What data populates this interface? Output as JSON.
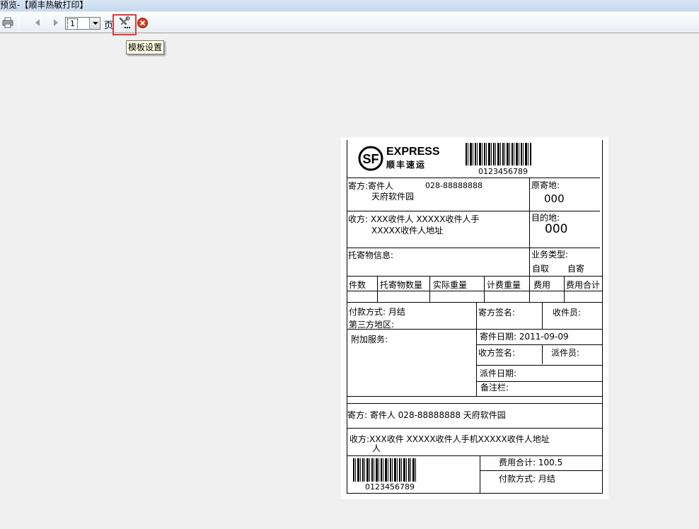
{
  "window": {
    "title": "预览-【顺丰热敏打印】"
  },
  "toolbar": {
    "page_select_value": "1",
    "page_word": "页",
    "tooltip": "模板设置"
  },
  "icons": [
    "printer-icon",
    "prev-page-icon",
    "next-page-icon",
    "template-settings-icon",
    "close-icon"
  ],
  "label": {
    "logo_brand": "EXPRESS",
    "logo_cn": "顺丰速运",
    "tracking_no": "0123456789",
    "sender": {
      "title": "寄方:寄件人",
      "phone": "028-88888888",
      "address": "天府软件园"
    },
    "origin": {
      "title": "原寄地:",
      "value": "000"
    },
    "receiver": {
      "line1": "收方: XXX收件人   XXXXX收件人手",
      "line2": "XXXXX收件人地址"
    },
    "destination": {
      "title": "目的地:",
      "value": "000"
    },
    "cargo_info": "托寄物信息:",
    "biz_type": {
      "title": "业务类型:",
      "opt1": "自取",
      "opt2": "自寄"
    },
    "table_headers": [
      "件数",
      "托寄物数量",
      "实际重量",
      "计费重量",
      "费用",
      "费用合计"
    ],
    "payment": "付款方式: 月结",
    "third_party": "第三方地区:",
    "sender_sign": "寄方签名:",
    "collector": "收件员:",
    "send_date": "寄件日期:  2011-09-09",
    "extra_service": "附加服务:",
    "receiver_sign": "收方签名:",
    "dispatcher": "派件员:",
    "delivery_date": "派件日期:",
    "remarks": "备注栏:",
    "stub_sender": "寄方: 寄件人    028-88888888    天府软件园",
    "stub_receiver_1": "收方:XXX收件   XXXXX收件人手机XXXXX收件人地址",
    "stub_receiver_2": "人",
    "fee_total": "费用合计: 100.5",
    "pay_method": "付款方式: 月结"
  }
}
